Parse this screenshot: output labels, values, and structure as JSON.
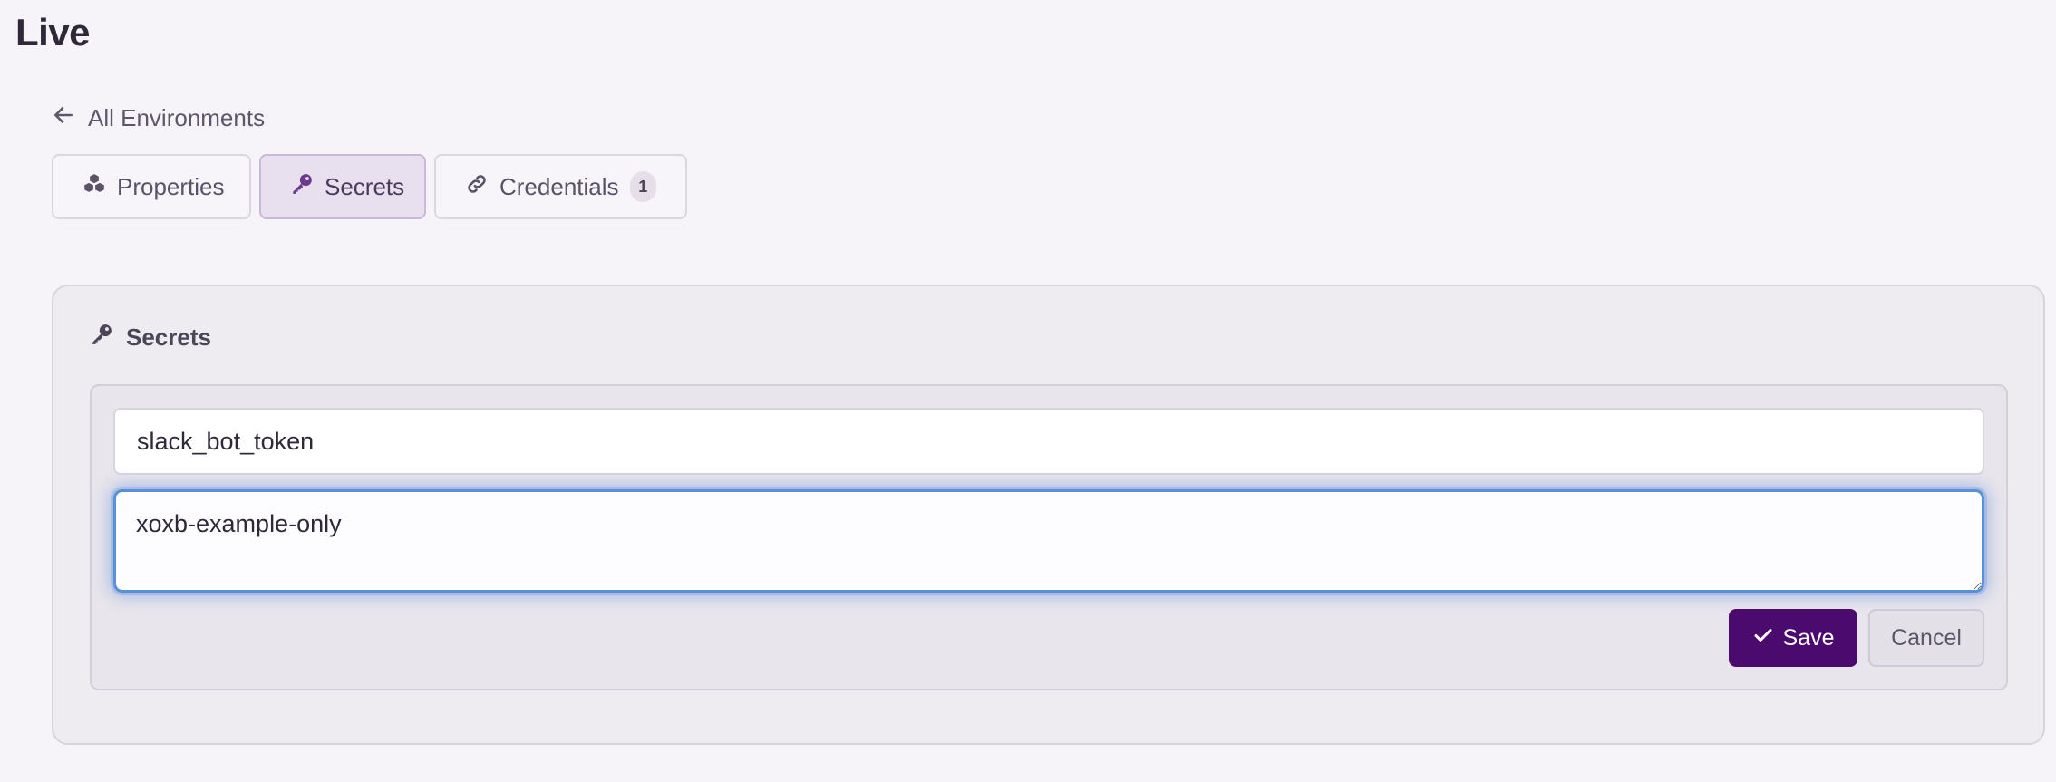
{
  "page": {
    "title": "Live"
  },
  "nav": {
    "back_label": "All Environments"
  },
  "tabs": [
    {
      "label": "Properties",
      "icon": "cubes-icon",
      "active": false
    },
    {
      "label": "Secrets",
      "icon": "key-icon",
      "active": true
    },
    {
      "label": "Credentials",
      "icon": "link-icon",
      "active": false,
      "badge": "1"
    }
  ],
  "secrets_panel": {
    "heading": "Secrets",
    "name_value": "slack_bot_token",
    "secret_value": "xoxb-example-only",
    "save_label": "Save",
    "cancel_label": "Cancel"
  },
  "colors": {
    "background": "#f6f4f8",
    "accent": "#4a0a6e",
    "active_tab": "#e9e0ef",
    "focus_ring": "#5b8fd6"
  }
}
